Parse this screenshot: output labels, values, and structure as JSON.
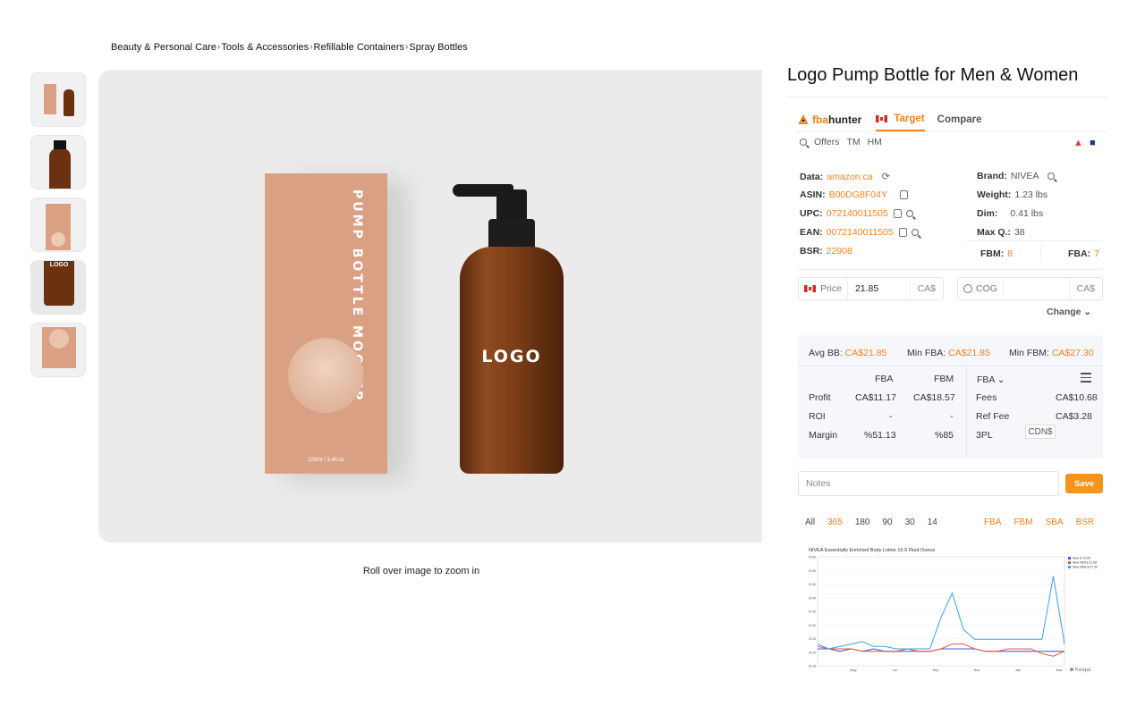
{
  "breadcrumb": [
    "Beauty & Personal Care",
    "Tools & Accessories",
    "Refillable Containers",
    "Spray Bottles"
  ],
  "breadcrumb_separator": "›",
  "product": {
    "title": "Logo Pump Bottle for Men & Women",
    "zoom_note": "Roll over image to zoom in",
    "box_text": "PUMP BOTTLE MOCKUP",
    "box_small_text": "100ml / 3.4fl.oz",
    "bottle_text": "LOGO",
    "thumbnail_count": 5
  },
  "extension": {
    "brand_prefix": "fba",
    "brand_suffix": "hunter",
    "tabs": [
      "Target",
      "Compare"
    ],
    "sub_links": [
      "Offers",
      "TM",
      "HM"
    ],
    "info": {
      "data_label": "Data:",
      "data_value": "amazon.ca",
      "asin_label": "ASIN:",
      "asin_value": "B00DG8F04Y",
      "upc_label": "UPC:",
      "upc_value": "072140011505",
      "ean_label": "EAN:",
      "ean_value": "0072140011505",
      "bsr_label": "BSR:",
      "bsr_value": "22908",
      "brand_label": "Brand:",
      "brand_value": "NIVEA",
      "weight_label": "Weight:",
      "weight_value": "1.23 lbs",
      "dim_label": "Dim:",
      "dim_value": "0.41 lbs",
      "maxq_label": "Max Q.:",
      "maxq_value": "38",
      "fbm_label": "FBM:",
      "fbm_value": "8",
      "fba_label": "FBA:",
      "fba_value": "7"
    },
    "price": {
      "label": "Price",
      "value": "21.85",
      "currency": "CA$"
    },
    "cog": {
      "label": "COG",
      "value": "",
      "currency": "CA$"
    },
    "change_label": "Change ⌄",
    "calc": {
      "avg_bb_label": "Avg BB:",
      "avg_bb": "CA$21.85",
      "min_fba_label": "Min FBA:",
      "min_fba": "CA$21.85",
      "min_fbm_label": "Min FBM:",
      "min_fbm": "CA$27.30",
      "col_fba": "FBA",
      "col_fbm": "FBM",
      "profit_label": "Profit",
      "profit_fba": "CA$11.17",
      "profit_fbm": "CA$18.57",
      "roi_label": "ROI",
      "roi_fba": "-",
      "roi_fbm": "-",
      "margin_label": "Margin",
      "margin_fba": "%51.13",
      "margin_fbm": "%85",
      "mode_select": "FBA ⌄",
      "fees_label": "Fees",
      "fees_value": "CA$10.68",
      "ref_fee_label": "Ref Fee",
      "ref_fee_value": "CA$3.28",
      "tpl_label": "3PL",
      "tpl_value": "CDN$"
    },
    "notes_placeholder": "Notes",
    "save_label": "Save",
    "ranges": [
      "All",
      "365",
      "180",
      "90",
      "30",
      "14"
    ],
    "active_range": "365",
    "series_toggles": [
      "FBA",
      "FBM",
      "SBA",
      "BSR"
    ],
    "accent_color": "#f4811f",
    "save_color": "#f7931e",
    "green_color": "#1dc58c"
  },
  "chart_data": {
    "type": "line",
    "title": "NIVEA Essentially Enriched Body Lotion 16.9 Fluid Ounce",
    "x_ticks": [
      "May",
      "Jul",
      "Sep",
      "Nov",
      "Jan",
      "Mar"
    ],
    "y_ticks": [
      "$ 60",
      "$ 50",
      "$ 45",
      "$ 40",
      "$ 35",
      "$ 30",
      "$ 25",
      "$ 20",
      "$ 15"
    ],
    "legend": [
      "New $ 19.95",
      "New FBA $ 21.85",
      "New FBM $ 27.30"
    ],
    "watermark": "Keepa",
    "series": [
      {
        "name": "New $ 19.95",
        "color": "#3b5bdb",
        "values": [
          22,
          22,
          21,
          22,
          21,
          22,
          21,
          21,
          21,
          21,
          21,
          22,
          22,
          22,
          22,
          21,
          21,
          21,
          21,
          21,
          21,
          21,
          21
        ]
      },
      {
        "name": "New FBA $ 21.85",
        "color": "#e8553d",
        "values": [
          23,
          22,
          22,
          22,
          21,
          21,
          21,
          21,
          22,
          21,
          21,
          22,
          24,
          24,
          22,
          21,
          21,
          22,
          22,
          22,
          20,
          19,
          21
        ]
      },
      {
        "name": "New FBM $ 27.30",
        "color": "#3aa0e8",
        "values": [
          24,
          22,
          23,
          24,
          25,
          23,
          23,
          22,
          22,
          22,
          22,
          35,
          45,
          30,
          26,
          26,
          26,
          26,
          26,
          26,
          26,
          52,
          24
        ]
      }
    ],
    "ylim": [
      15,
      60
    ]
  }
}
